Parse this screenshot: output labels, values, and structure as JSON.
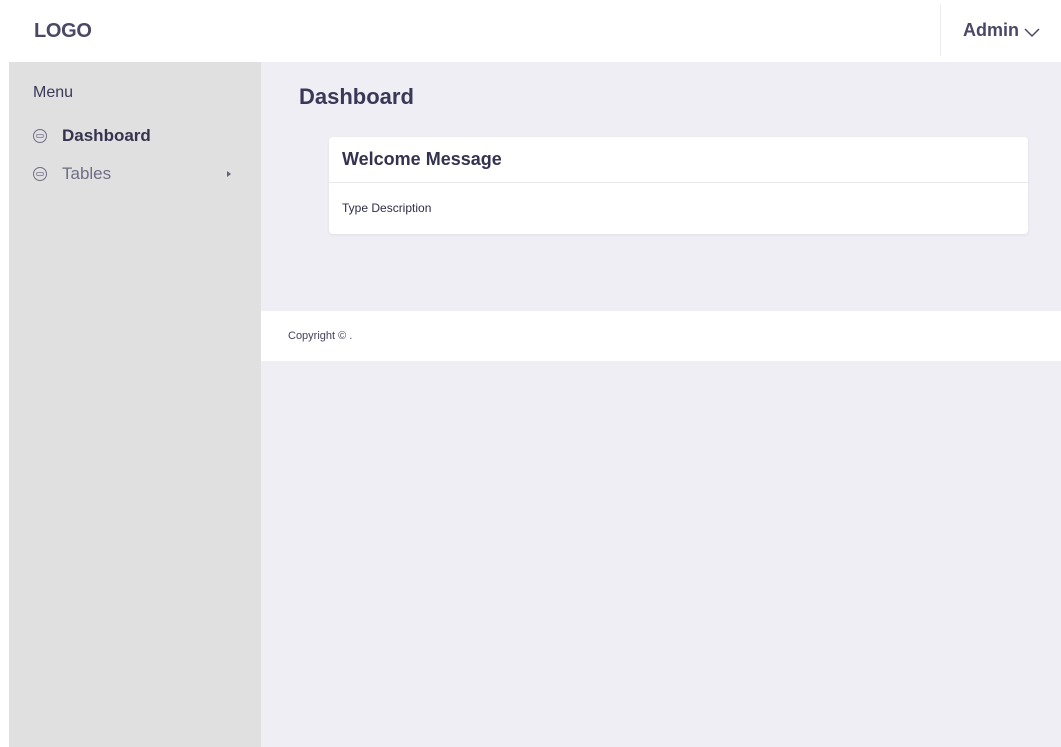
{
  "header": {
    "logo": "LOGO",
    "user_menu_label": "Admin"
  },
  "sidebar": {
    "title": "Menu",
    "items": [
      {
        "label": "Dashboard",
        "icon": "circle-placeholder-icon",
        "active": true
      },
      {
        "label": "Tables",
        "icon": "circle-placeholder-icon",
        "has_submenu": true
      }
    ]
  },
  "main": {
    "page_title": "Dashboard",
    "card": {
      "title": "Welcome Message",
      "description": "Type Description"
    }
  },
  "footer": {
    "copyright": "Copyright © ."
  },
  "colors": {
    "sidebar_bg": "#e0e0e0",
    "content_bg": "#eeeef4",
    "text_primary": "#3a3856"
  }
}
